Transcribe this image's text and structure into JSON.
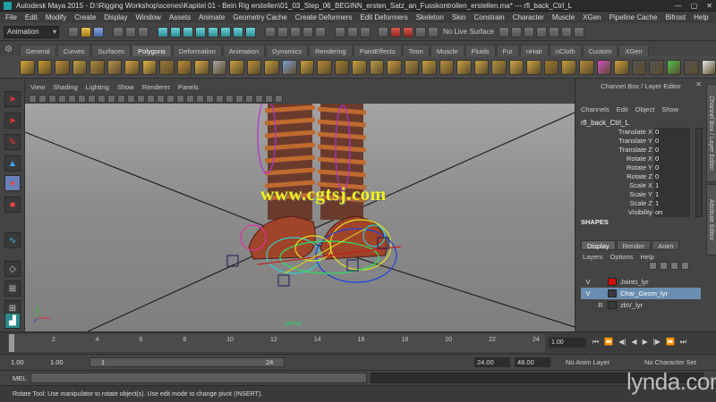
{
  "window": {
    "title": "Autodesk Maya 2015 - D:\\Rigging Workshop\\scenes\\Kapitel 01 - Bein Rig erstellen\\01_03_Step_06_BEGINN_ersten_Satz_an_Fusskontrollen_erstellen.ma*   ---   rfl_back_Ctrl_L",
    "minimize": "—",
    "maximize": "▢",
    "close": "✕"
  },
  "menubar": [
    "File",
    "Edit",
    "Modify",
    "Create",
    "Display",
    "Window",
    "Assets",
    "Animate",
    "Geometry Cache",
    "Create Deformers",
    "Edit Deformers",
    "Skeleton",
    "Skin",
    "Constrain",
    "Character",
    "Muscle",
    "XGen",
    "Pipeline Cache",
    "Bifrost",
    "Help"
  ],
  "statusline": {
    "mode": "Animation",
    "live_surface": "No Live Surface"
  },
  "shelf": {
    "tabs": [
      "General",
      "Curves",
      "Surfaces",
      "Polygons",
      "Deformation",
      "Animation",
      "Dynamics",
      "Rendering",
      "PaintEffects",
      "Toon",
      "Muscle",
      "Fluids",
      "Fur",
      "nHair",
      "nCloth",
      "Custom",
      "XGen"
    ],
    "active_tab": "Polygons"
  },
  "panel": {
    "menu": [
      "View",
      "Shading",
      "Lighting",
      "Show",
      "Renderer",
      "Panels"
    ],
    "camera_label": "persp"
  },
  "watermark": "www.cgtsj.com",
  "channel_box": {
    "title": "Channel Box / Layer Editor",
    "menu": [
      "Channels",
      "Edit",
      "Object",
      "Show"
    ],
    "object_name": "rfl_back_Ctrl_L",
    "attributes": [
      {
        "label": "Translate X",
        "value": "0"
      },
      {
        "label": "Translate Y",
        "value": "0"
      },
      {
        "label": "Translate Z",
        "value": "0"
      },
      {
        "label": "Rotate X",
        "value": "0"
      },
      {
        "label": "Rotate Y",
        "value": "0"
      },
      {
        "label": "Rotate Z",
        "value": "0"
      },
      {
        "label": "Scale X",
        "value": "1"
      },
      {
        "label": "Scale Y",
        "value": "1"
      },
      {
        "label": "Scale Z",
        "value": "1"
      },
      {
        "label": "Visibility",
        "value": "on"
      }
    ],
    "shapes_header": "SHAPES",
    "side_tabs": [
      "Channel Box / Layer Editor",
      "Attribute Editor"
    ]
  },
  "layer_editor": {
    "tabs": [
      "Display",
      "Render",
      "Anim"
    ],
    "active_tab": "Display",
    "menu": [
      "Layers",
      "Options",
      "Help"
    ],
    "layers": [
      {
        "flag1": "V",
        "flag2": "",
        "color": "#d01010",
        "name": "Joints_lyr",
        "selected": false
      },
      {
        "flag1": "V",
        "flag2": "",
        "color": "#3a3a3a",
        "name": "Char_Geom_lyr",
        "selected": true
      },
      {
        "flag1": "",
        "flag2": "R",
        "color": "#3a3a3a",
        "name": "zbV_lyr",
        "selected": false
      }
    ]
  },
  "timeslider": {
    "ticks": [
      "1",
      "2",
      "4",
      "6",
      "8",
      "10",
      "12",
      "14",
      "16",
      "18",
      "20",
      "22",
      "24"
    ],
    "current_frame": "1.00"
  },
  "rangeslider": {
    "start": "1.00",
    "anim_start": "1.00",
    "range_start": "1",
    "range_end": "24",
    "anim_end": "24.00",
    "end": "48.00",
    "anim_layer": "No Anim Layer",
    "character_set": "No Character Set"
  },
  "command_line": {
    "label": "MEL"
  },
  "help_line": "Rotate Tool: Use manipulator to rotate object(s). Use edit mode to change pivot (INSERT).",
  "brand_watermark": "lynda.com",
  "colors": {
    "accent_selection": "#6a8eb0",
    "watermark_yellow": "#f0f020",
    "persp_green": "#2fd061"
  }
}
